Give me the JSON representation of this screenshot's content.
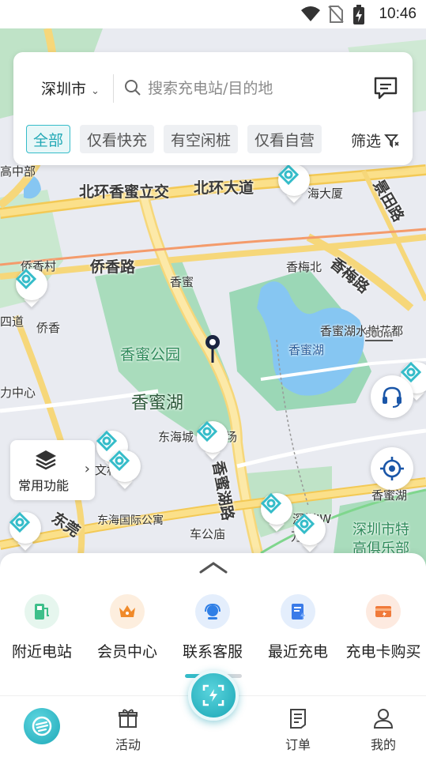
{
  "status_bar": {
    "time": "10:46"
  },
  "search_card": {
    "city": "深圳市",
    "search_placeholder": "搜索充电站/目的地",
    "chips": [
      "全部",
      "仅看快充",
      "有空闲桩",
      "仅看自营"
    ],
    "filter_label": "筛选"
  },
  "map": {
    "labels": {
      "beihuan_xiangmi": "北环香蜜立交",
      "beihuan_road": "北环大道",
      "jingtian": "景田路",
      "haidasha": "海大厦",
      "qiaoxiang_road": "侨香路",
      "xiangmei_north": "香梅北",
      "xiangmei_road": "香梅路",
      "qiaoxiang_village": "侨香村",
      "xiangmi_station": "香蜜",
      "qiaoxiang_station": "侨香",
      "xiangmi_park": "香蜜公园",
      "xiangmi_lake_district": "香蜜湖",
      "xiangmihu_water": "香蜜湖",
      "xiangmihu_garden": "香蜜湖水榭花都",
      "scale": "500m",
      "donghai_city": "东海城",
      "donghai_apartment": "东海国际公寓",
      "chegongmiao": "车公庙",
      "xiangmihu_road": "香蜜湖路",
      "shenzhen_jw": "深圳JW",
      "shenzhen_club": "深圳市特",
      "xiangmihu_small": "香蜜湖",
      "dongyuan": "东莞",
      "gaojule": "高俱乐部",
      "sidao": "四道",
      "lizhongxin": "力中心",
      "wanxiang": "万象",
      "wen": "文林",
      "gaozhong": "高中部",
      "chang": "场"
    },
    "common_functions_label": "常用功能"
  },
  "quick_actions": [
    {
      "label": "附近电站",
      "icon": "nearby-station-icon",
      "color": "#3dbf8a"
    },
    {
      "label": "会员中心",
      "icon": "crown-icon",
      "color": "#f08a2a"
    },
    {
      "label": "联系客服",
      "icon": "headset-icon",
      "color": "#2f7fe6"
    },
    {
      "label": "最近充电",
      "icon": "recent-charge-icon",
      "color": "#3a7be8"
    },
    {
      "label": "充电卡购买",
      "icon": "charge-card-icon",
      "color": "#f07a3a"
    }
  ],
  "tabs": {
    "activity": "活动",
    "orders": "订单",
    "mine": "我的"
  },
  "colors": {
    "accent": "#35bcc9",
    "road_yellow": "#f5cf5e",
    "park_green": "#9ed8b4",
    "water_blue": "#7ec3f0"
  }
}
